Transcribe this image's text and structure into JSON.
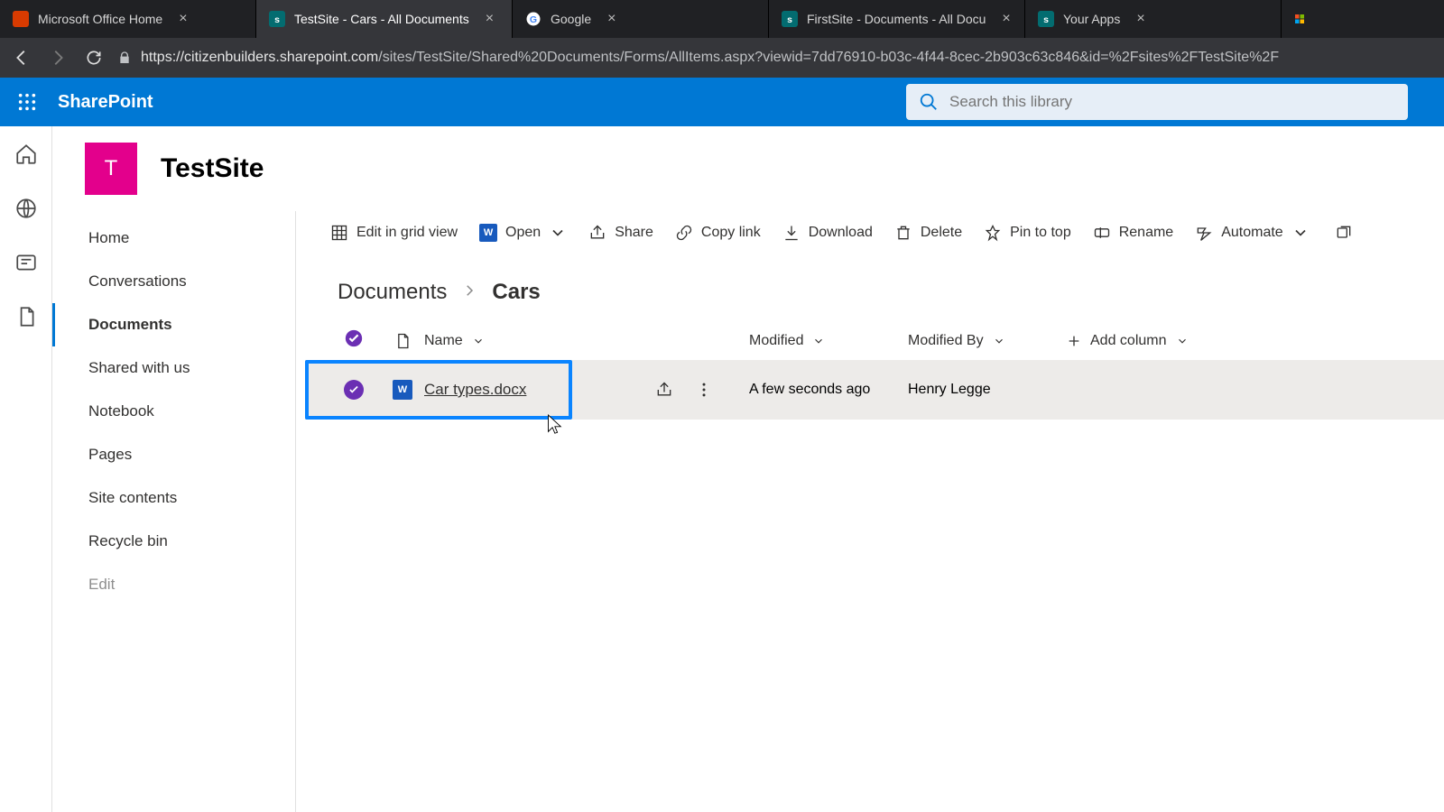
{
  "browser": {
    "tabs": [
      {
        "title": "Microsoft Office Home"
      },
      {
        "title": "TestSite - Cars - All Documents"
      },
      {
        "title": "Google"
      },
      {
        "title": "FirstSite - Documents - All Docu"
      },
      {
        "title": "Your Apps"
      }
    ],
    "url_host": "https://citizenbuilders.sharepoint.com",
    "url_path": "/sites/TestSite/Shared%20Documents/Forms/AllItems.aspx?viewid=7dd76910-b03c-4f44-8cec-2b903c63c846&id=%2Fsites%2FTestSite%2F"
  },
  "suite": {
    "brand": "SharePoint",
    "search_placeholder": "Search this library"
  },
  "site": {
    "initial": "T",
    "name": "TestSite"
  },
  "leftnav": {
    "items": [
      "Home",
      "Conversations",
      "Documents",
      "Shared with us",
      "Notebook",
      "Pages",
      "Site contents",
      "Recycle bin",
      "Edit"
    ],
    "selected_index": 2
  },
  "cmdbar": {
    "edit_grid": "Edit in grid view",
    "open": "Open",
    "share": "Share",
    "copy_link": "Copy link",
    "download": "Download",
    "delete": "Delete",
    "pin": "Pin to top",
    "rename": "Rename",
    "automate": "Automate"
  },
  "breadcrumb": {
    "root": "Documents",
    "current": "Cars"
  },
  "columns": {
    "name": "Name",
    "modified": "Modified",
    "modified_by": "Modified By",
    "add_column": "Add column"
  },
  "rows": [
    {
      "name": "Car types.docx",
      "modified": "A few seconds ago",
      "modified_by": "Henry Legge"
    }
  ]
}
